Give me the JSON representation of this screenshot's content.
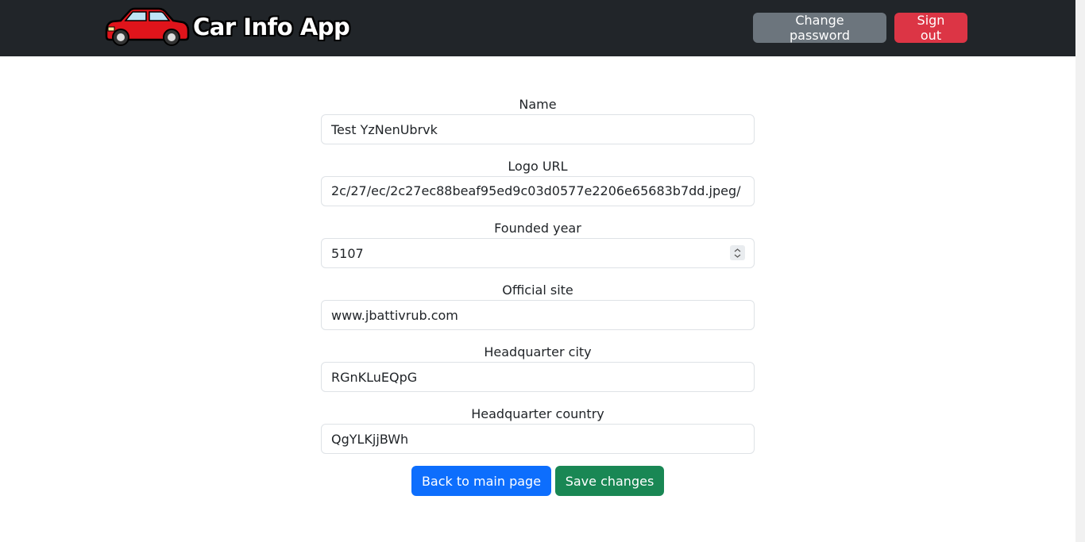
{
  "header": {
    "brand_text": "Car Info App",
    "logo_icon": "red-car-icon",
    "change_password_label": "Change password",
    "sign_out_label": "Sign out"
  },
  "form": {
    "name": {
      "label": "Name",
      "value": "Test YzNenUbrvk"
    },
    "logo_url": {
      "label": "Logo URL",
      "value": "/2c/27/ec/2c27ec88beaf95ed9c03d0577e2206e65683b7dd.jpeg"
    },
    "founded_year": {
      "label": "Founded year",
      "value": "5107"
    },
    "official_site": {
      "label": "Official site",
      "value": "www.jbattivrub.com"
    },
    "hq_city": {
      "label": "Headquarter city",
      "value": "RGnKLuEQpG"
    },
    "hq_country": {
      "label": "Headquarter country",
      "value": "QgYLKjjBWh"
    }
  },
  "actions": {
    "back_label": "Back to main page",
    "save_label": "Save changes"
  },
  "colors": {
    "navbar": "#212529",
    "secondary": "#6c757d",
    "danger": "#dc3545",
    "primary": "#0d6efd",
    "success": "#198754"
  }
}
